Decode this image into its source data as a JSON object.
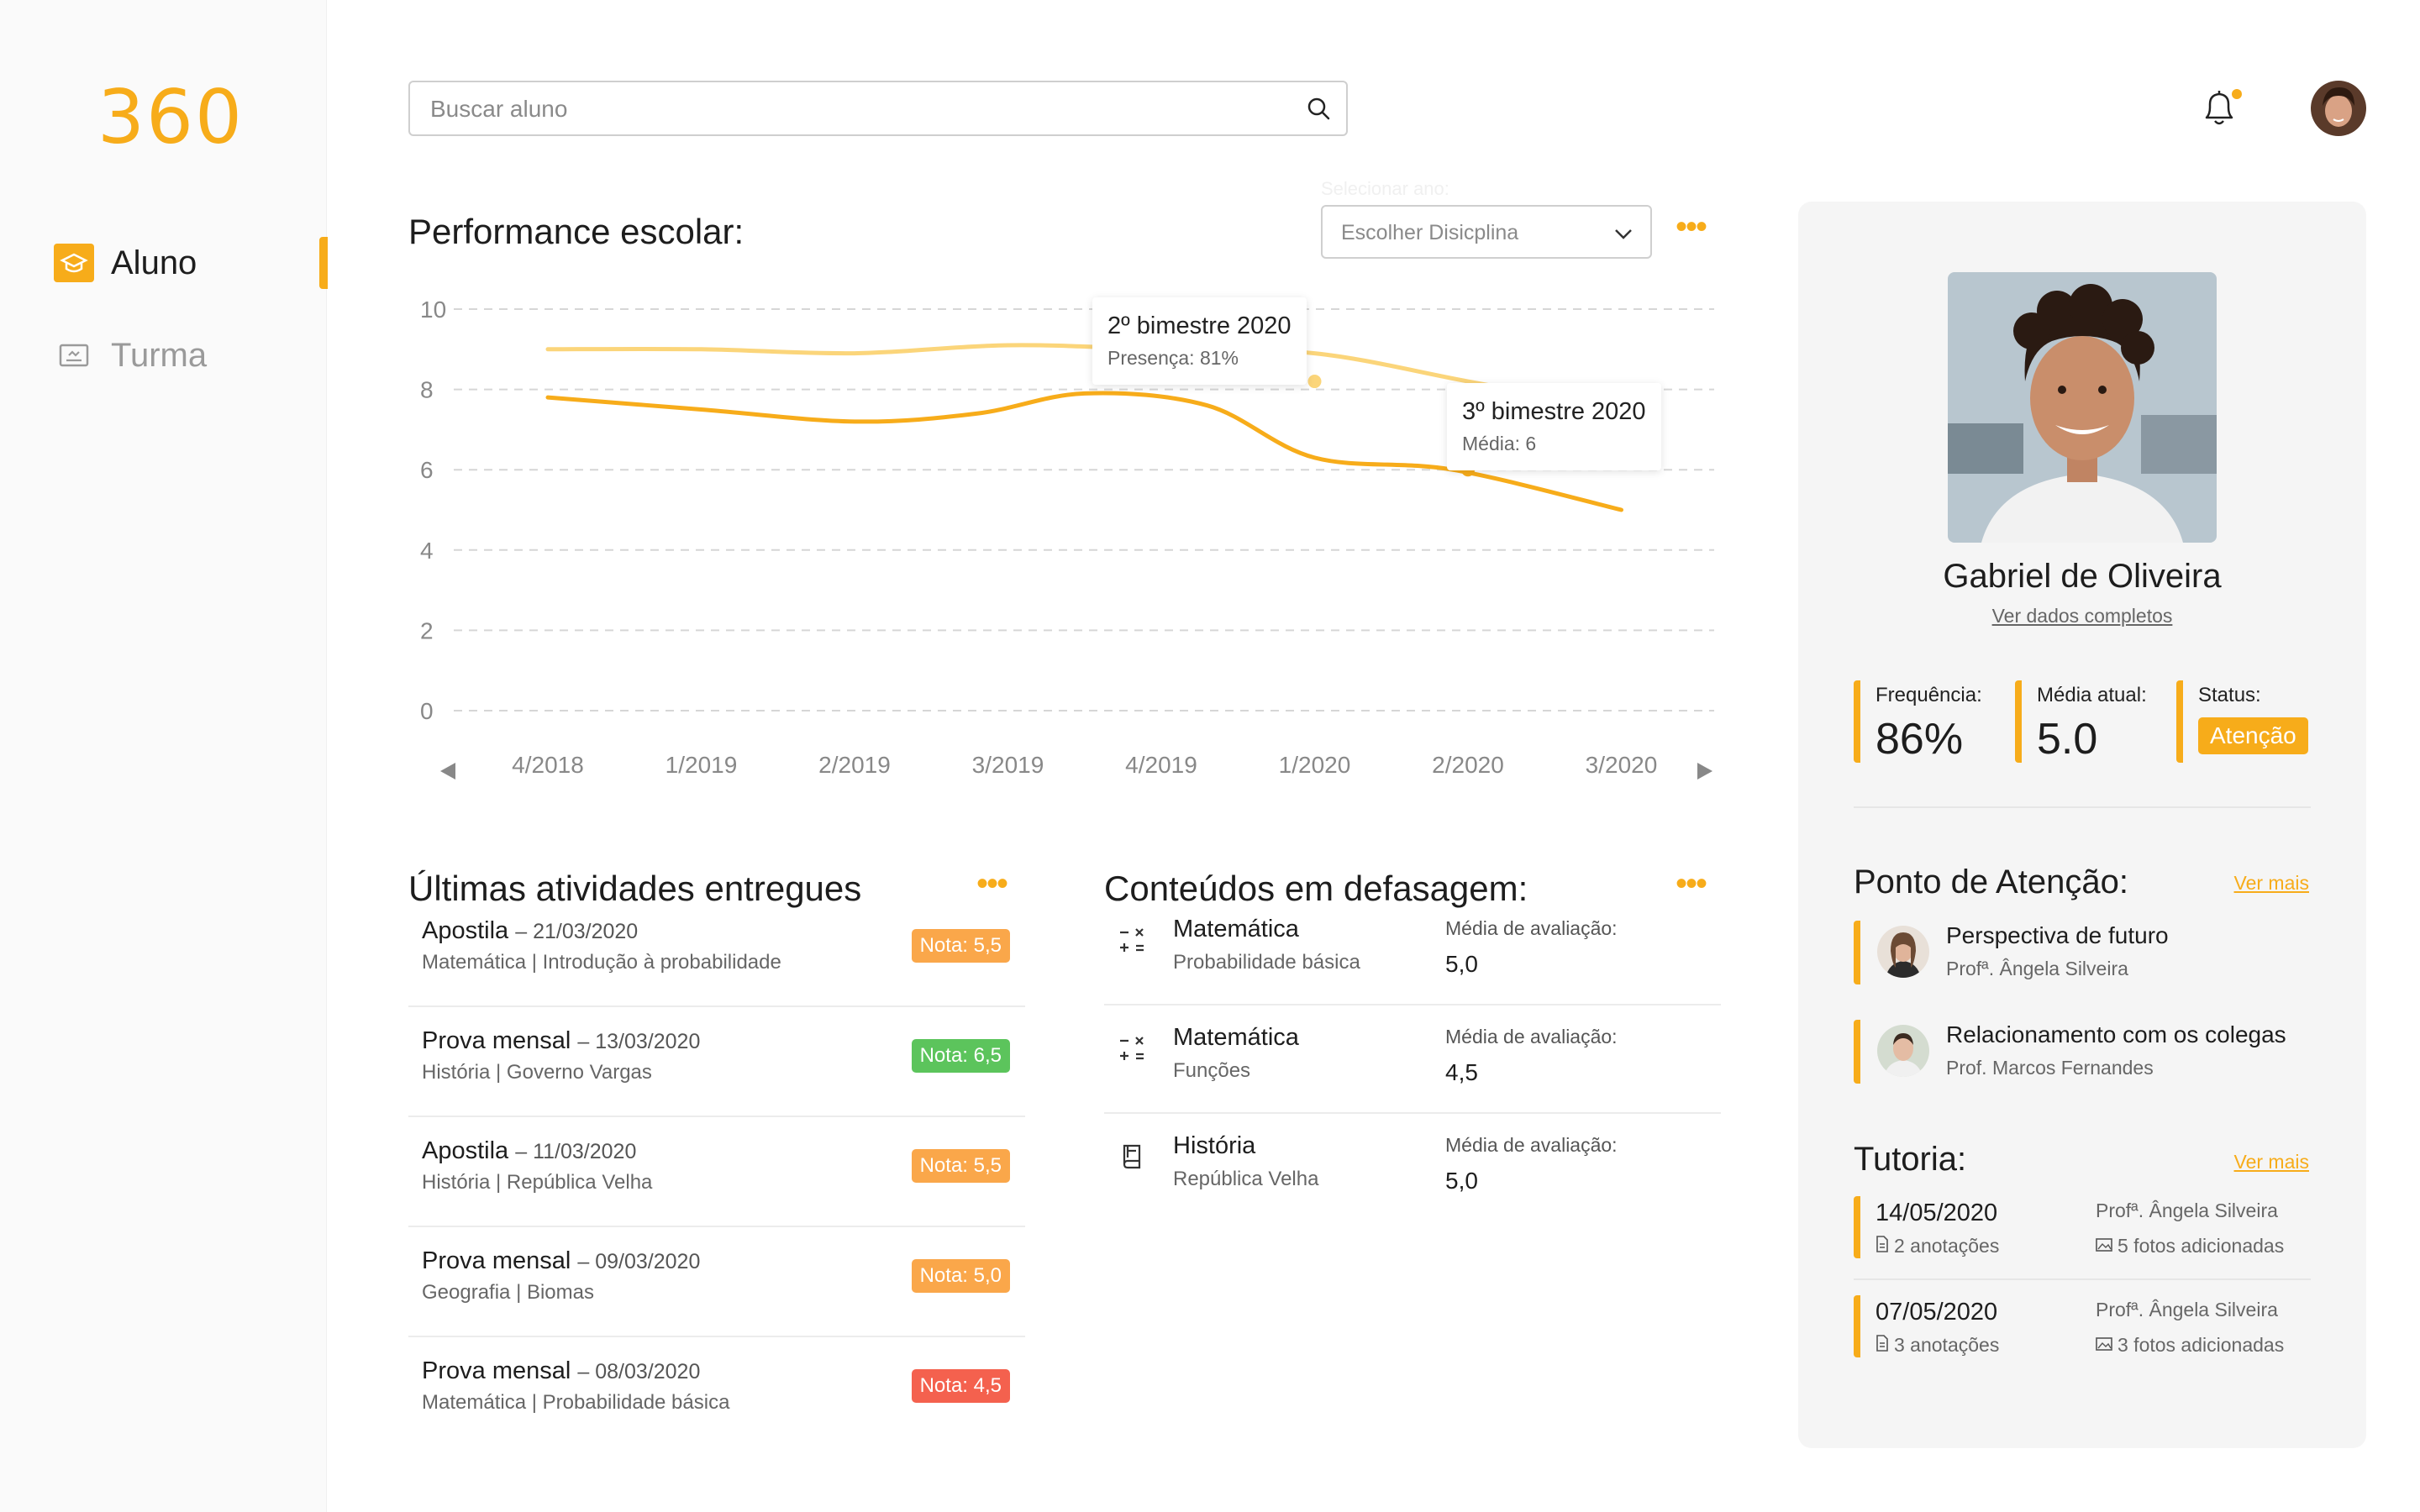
{
  "brand": {
    "logo": "360",
    "accent": "#F7AC1A"
  },
  "nav": [
    {
      "label": "Aluno",
      "icon": "student-cap-icon",
      "active": true
    },
    {
      "label": "Turma",
      "icon": "classroom-board-icon",
      "active": false
    }
  ],
  "search": {
    "placeholder": "Buscar aluno",
    "value": ""
  },
  "performance": {
    "title": "Performance escolar:",
    "year_hint": "Selecionar ano:",
    "discipline_select": "Escolher Disicplina",
    "tooltips": [
      {
        "title": "2º bimestre 2020",
        "subtitle": "Presença: 81%"
      },
      {
        "title": "3º bimestre 2020",
        "subtitle": "Média: 6"
      }
    ]
  },
  "chart_data": {
    "type": "line",
    "categories": [
      "4/2018",
      "1/2019",
      "2/2019",
      "3/2019",
      "4/2019",
      "1/2020",
      "2/2020",
      "3/2020"
    ],
    "ylim": [
      0,
      10
    ],
    "yticks": [
      0,
      2,
      4,
      6,
      8,
      10
    ],
    "series": [
      {
        "values": [
          9.0,
          9.0,
          8.9,
          9.1,
          9.0,
          8.9,
          8.2,
          7.5
        ],
        "color": "#FBD57A"
      },
      {
        "values": [
          7.8,
          7.5,
          7.2,
          7.4,
          7.9,
          7.6,
          6.3,
          6.0,
          5.0
        ],
        "x": [
          0,
          1,
          2,
          2.8,
          3.5,
          4.3,
          5.0,
          5.9,
          7.0
        ],
        "color": "#F7AC1A"
      }
    ],
    "points": [
      {
        "x": 5.0,
        "y": 8.2,
        "color": "#FBD57A"
      },
      {
        "x": 6.0,
        "y": 6.0,
        "color": "#F7AC1A"
      }
    ],
    "grid": true
  },
  "activities": {
    "title": "Últimas atividades entregues",
    "items": [
      {
        "name": "Apostila",
        "date": "– 21/03/2020",
        "detail": "Matemática | Introdução à probabilidade",
        "grade": "Nota: 5,5",
        "color": "#FAA74A"
      },
      {
        "name": "Prova mensal",
        "date": "– 13/03/2020",
        "detail": "História | Governo Vargas",
        "grade": "Nota: 6,5",
        "color": "#5CC45C"
      },
      {
        "name": "Apostila",
        "date": "– 11/03/2020",
        "detail": "História | República Velha",
        "grade": "Nota: 5,5",
        "color": "#FAA74A"
      },
      {
        "name": "Prova mensal",
        "date": "– 09/03/2020",
        "detail": "Geografia | Biomas",
        "grade": "Nota: 5,0",
        "color": "#FAA74A"
      },
      {
        "name": "Prova mensal",
        "date": "– 08/03/2020",
        "detail": "Matemática | Probabilidade básica",
        "grade": "Nota: 4,5",
        "color": "#F4614E"
      }
    ]
  },
  "contents": {
    "title": "Conteúdos em defasagem:",
    "items": [
      {
        "subject": "Matemática",
        "topic": "Probabilidade básica",
        "label": "Média de avaliação:",
        "value": "5,0",
        "icon": "math-operators-icon"
      },
      {
        "subject": "Matemática",
        "topic": "Funções",
        "label": "Média de avaliação:",
        "value": "4,5",
        "icon": "math-operators-icon"
      },
      {
        "subject": "História",
        "topic": "República Velha",
        "label": "Média de avaliação:",
        "value": "5,0",
        "icon": "history-book-icon"
      }
    ]
  },
  "student": {
    "name": "Gabriel de Oliveira",
    "link": "Ver dados completos",
    "stats": [
      {
        "label": "Frequência:",
        "value": "86%"
      },
      {
        "label": "Média atual:",
        "value": "5.0"
      },
      {
        "label": "Status:",
        "value": "Atenção"
      }
    ]
  },
  "attention": {
    "title": "Ponto de Atenção:",
    "more": "Ver mais",
    "items": [
      {
        "title": "Perspectiva de futuro",
        "teacher": "Profª. Ângela Silveira"
      },
      {
        "title": "Relacionamento com os colegas",
        "teacher": "Prof. Marcos Fernandes"
      }
    ]
  },
  "tutoring": {
    "title": "Tutoria:",
    "more": "Ver mais",
    "items": [
      {
        "date": "14/05/2020",
        "notes": "2 anotações",
        "teacher": "Profª. Ângela Silveira",
        "photos": "5 fotos adicionadas"
      },
      {
        "date": "07/05/2020",
        "notes": "3 anotações",
        "teacher": "Profª. Ângela Silveira",
        "photos": "3 fotos adicionadas"
      }
    ]
  }
}
